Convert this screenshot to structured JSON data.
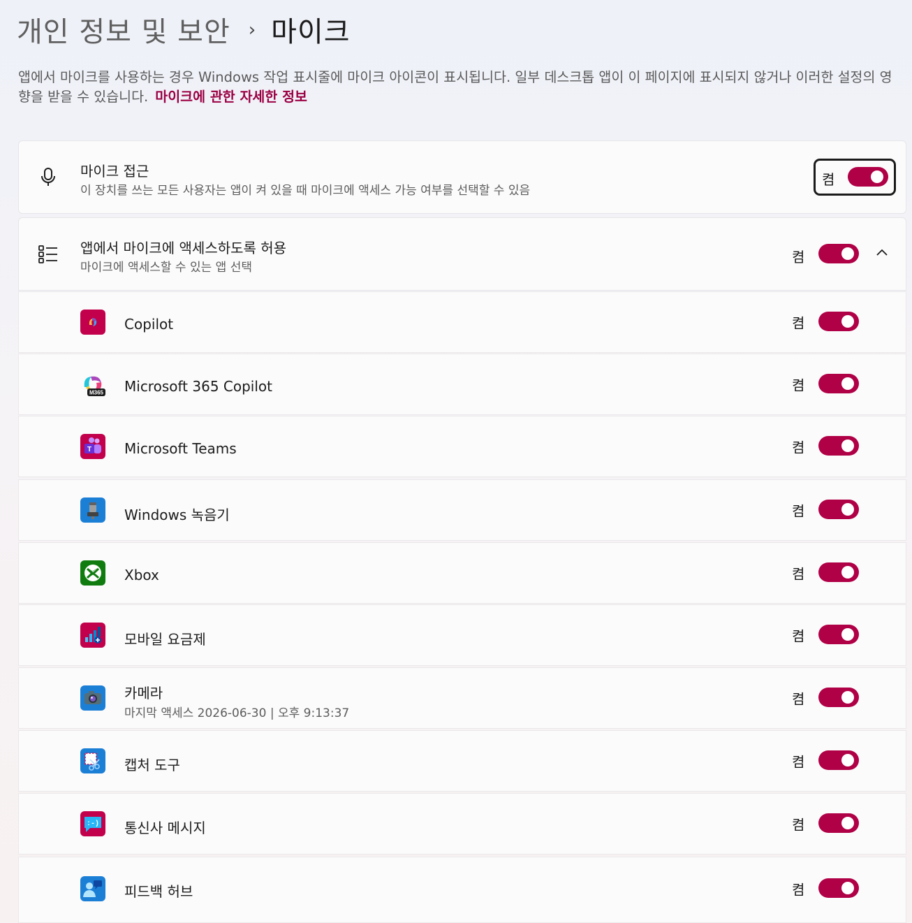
{
  "breadcrumb": {
    "parent": "개인 정보 및 보안",
    "separator": "›",
    "current": "마이크"
  },
  "description": {
    "text": "앱에서 마이크를 사용하는 경우 Windows 작업 표시줄에 마이크 아이콘이 표시됩니다. 일부 데스크톱 앱이 이 페이지에 표시되지 않거나 이러한 설정의 영향을 받을 수 있습니다.",
    "link": "마이크에 관한 자세한 정보"
  },
  "mic_access": {
    "title": "마이크 접근",
    "subtitle": "이 장치를 쓰는 모든 사용자는 앱이 켜 있을 때 마이크에 액세스 가능 여부를 선택할 수 있음",
    "state": "켬",
    "icon": "microphone-icon"
  },
  "app_access": {
    "title": "앱에서 마이크에 액세스하도록 허용",
    "subtitle": "마이크에 액세스할 수 있는 앱 선택",
    "state": "켬",
    "icon": "list-icon",
    "expand_icon": "chevron-up-icon"
  },
  "apps": [
    {
      "name": "Copilot",
      "state": "켬",
      "icon": "copilot-icon",
      "color": "#c2004b"
    },
    {
      "name": "Microsoft 365 Copilot",
      "state": "켬",
      "icon": "m365-copilot-icon",
      "color": "#5b5fc7"
    },
    {
      "name": "Microsoft Teams",
      "state": "켬",
      "icon": "teams-icon",
      "color": "#c2004b"
    },
    {
      "name": "Windows 녹음기",
      "state": "켬",
      "icon": "voice-recorder-icon",
      "color": "#1c7fd6"
    },
    {
      "name": "Xbox",
      "state": "켬",
      "icon": "xbox-icon",
      "color": "#107c10"
    },
    {
      "name": "모바일 요금제",
      "state": "켬",
      "icon": "mobile-plans-icon",
      "color": "#c2004b"
    },
    {
      "name": "카메라",
      "sub": "마지막 액세스 2026-06-30  |  오후 9:13:37",
      "state": "켬",
      "icon": "camera-icon",
      "color": "#1c7fd6"
    },
    {
      "name": "캡처 도구",
      "state": "켬",
      "icon": "snipping-tool-icon",
      "color": "#1c7fd6"
    },
    {
      "name": "통신사 메시지",
      "state": "켬",
      "icon": "carrier-messaging-icon",
      "color": "#c2004b"
    },
    {
      "name": "피드백 허브",
      "state": "켬",
      "icon": "feedback-hub-icon",
      "color": "#1c7fd6"
    }
  ],
  "colors": {
    "accent": "#b00046",
    "link": "#9b0042"
  }
}
